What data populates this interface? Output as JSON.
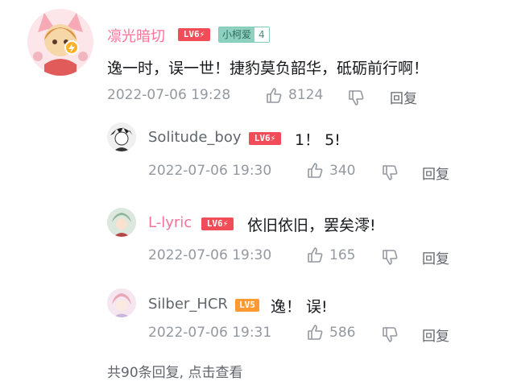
{
  "main_comment": {
    "username": "凛光暗切",
    "level_badge": "LV6",
    "fan_badge": {
      "name": "小柯爱",
      "level": "4"
    },
    "text": "逸一时，误一世！捷豹莫负韶华，砥砺前行啊！",
    "time": "2022-07-06 19:28",
    "likes": "8124",
    "reply_label": "回复",
    "like_icon": "thumbs-up-icon",
    "dislike_icon": "thumbs-down-icon"
  },
  "replies": [
    {
      "username": "Solitude_boy",
      "level_badge": "LV6",
      "text": "1！ 5!",
      "time": "2022-07-06 19:30",
      "likes": "340",
      "reply_label": "回复"
    },
    {
      "username": "L-lyric",
      "level_badge": "LV6",
      "text": "依旧依旧，罢矣澪!",
      "time": "2022-07-06 19:30",
      "likes": "165",
      "reply_label": "回复"
    },
    {
      "username": "Silber_HCR",
      "level_badge": "LV5",
      "text": "逸！ 误!",
      "time": "2022-07-06 19:31",
      "likes": "586",
      "reply_label": "回复"
    }
  ],
  "footer": {
    "text": "共90条回复, 点击查看"
  },
  "colors": {
    "vip_name": "#fb7299",
    "level6": "#f14d58",
    "level5": "#ff9a33",
    "meta": "#9499a0"
  }
}
